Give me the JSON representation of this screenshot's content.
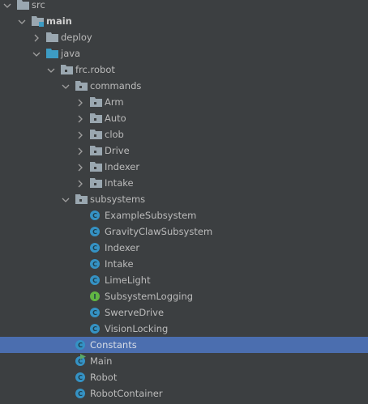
{
  "colors": {
    "background": "#3c3f41",
    "selection": "#4b6eaf",
    "class_icon": "#3592c4",
    "interface_icon": "#62b543",
    "folder": "#9aa7b0",
    "source_folder": "#3d9cc4"
  },
  "tree": [
    {
      "label": "src",
      "level": 0,
      "type": "folder",
      "expanded": true
    },
    {
      "label": "main",
      "level": 1,
      "type": "module-folder",
      "expanded": true,
      "bold": true
    },
    {
      "label": "deploy",
      "level": 2,
      "type": "folder",
      "expanded": false
    },
    {
      "label": "java",
      "level": 2,
      "type": "source-folder",
      "expanded": true
    },
    {
      "label": "frc.robot",
      "level": 3,
      "type": "package",
      "expanded": true
    },
    {
      "label": "commands",
      "level": 4,
      "type": "package",
      "expanded": true
    },
    {
      "label": "Arm",
      "level": 5,
      "type": "package",
      "expanded": false
    },
    {
      "label": "Auto",
      "level": 5,
      "type": "package",
      "expanded": false
    },
    {
      "label": "clob",
      "level": 5,
      "type": "package",
      "expanded": false
    },
    {
      "label": "Drive",
      "level": 5,
      "type": "package",
      "expanded": false
    },
    {
      "label": "Indexer",
      "level": 5,
      "type": "package",
      "expanded": false
    },
    {
      "label": "Intake",
      "level": 5,
      "type": "package",
      "expanded": false
    },
    {
      "label": "subsystems",
      "level": 4,
      "type": "package",
      "expanded": true
    },
    {
      "label": "ExampleSubsystem",
      "level": 5,
      "type": "class"
    },
    {
      "label": "GravityClawSubsystem",
      "level": 5,
      "type": "class"
    },
    {
      "label": "Indexer",
      "level": 5,
      "type": "class"
    },
    {
      "label": "Intake",
      "level": 5,
      "type": "class"
    },
    {
      "label": "LimeLight",
      "level": 5,
      "type": "class"
    },
    {
      "label": "SubsystemLogging",
      "level": 5,
      "type": "interface"
    },
    {
      "label": "SwerveDrive",
      "level": 5,
      "type": "class"
    },
    {
      "label": "VisionLocking",
      "level": 5,
      "type": "class"
    },
    {
      "label": "Constants",
      "level": 4,
      "type": "class",
      "selected": true
    },
    {
      "label": "Main",
      "level": 4,
      "type": "main-class"
    },
    {
      "label": "Robot",
      "level": 4,
      "type": "class"
    },
    {
      "label": "RobotContainer",
      "level": 4,
      "type": "class"
    }
  ]
}
